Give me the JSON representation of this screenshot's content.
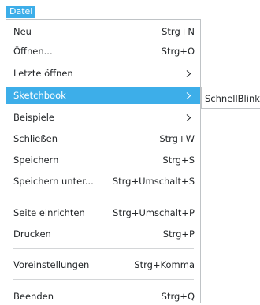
{
  "menubar": {
    "file_menu_label": "Datei"
  },
  "menu": {
    "items": [
      {
        "label": "Neu",
        "shortcut": "Strg+N"
      },
      {
        "label": "Öffnen...",
        "shortcut": "Strg+O"
      },
      {
        "label": "Letzte öffnen",
        "shortcut": "",
        "submenu_icon": "chevron-right-icon"
      },
      {
        "label": "Sketchbook",
        "shortcut": "",
        "submenu_icon": "chevron-right-icon"
      },
      {
        "label": "Beispiele",
        "shortcut": "",
        "submenu_icon": "chevron-right-icon"
      },
      {
        "label": "Schließen",
        "shortcut": "Strg+W"
      },
      {
        "label": "Speichern",
        "shortcut": "Strg+S"
      },
      {
        "label": "Speichern unter...",
        "shortcut": "Strg+Umschalt+S"
      },
      {
        "label": "Seite einrichten",
        "shortcut": "Strg+Umschalt+P"
      },
      {
        "label": "Drucken",
        "shortcut": "Strg+P"
      },
      {
        "label": "Voreinstellungen",
        "shortcut": "Strg+Komma"
      },
      {
        "label": "Beenden",
        "shortcut": "Strg+Q"
      }
    ]
  },
  "submenu": {
    "items": [
      {
        "label": "SchnellBlink"
      }
    ]
  },
  "colors": {
    "highlight": "#3daee9",
    "highlight_text": "#ffffff",
    "text": "#232629",
    "border": "#bfc3c6",
    "separator": "#d4d6d8"
  }
}
